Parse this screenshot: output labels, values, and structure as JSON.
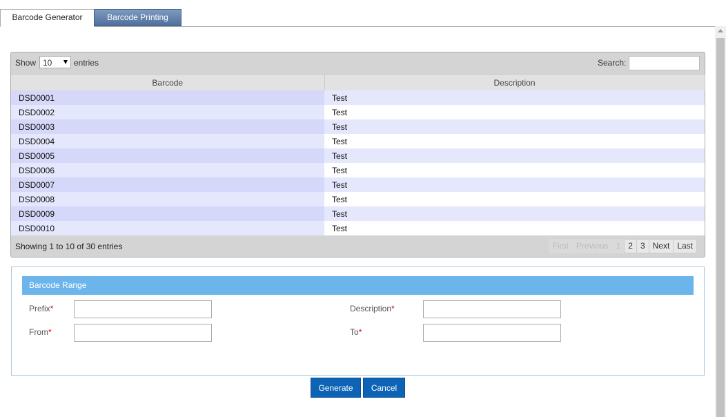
{
  "tabs": [
    {
      "label": "Barcode Generator",
      "active": true
    },
    {
      "label": "Barcode Printing",
      "active": false
    }
  ],
  "grid": {
    "show_label": "Show",
    "page_size": "10",
    "entries_label": "entries",
    "search_label": "Search:",
    "search_value": "",
    "columns": [
      "Barcode",
      "Description"
    ],
    "rows": [
      {
        "barcode": "DSD0001",
        "description": "Test"
      },
      {
        "barcode": "DSD0002",
        "description": "Test"
      },
      {
        "barcode": "DSD0003",
        "description": "Test"
      },
      {
        "barcode": "DSD0004",
        "description": "Test"
      },
      {
        "barcode": "DSD0005",
        "description": "Test"
      },
      {
        "barcode": "DSD0006",
        "description": "Test"
      },
      {
        "barcode": "DSD0007",
        "description": "Test"
      },
      {
        "barcode": "DSD0008",
        "description": "Test"
      },
      {
        "barcode": "DSD0009",
        "description": "Test"
      },
      {
        "barcode": "DSD0010",
        "description": "Test"
      }
    ],
    "info": "Showing 1 to 10 of 30 entries",
    "pager": {
      "first": "First",
      "previous": "Previous",
      "pages": [
        "1",
        "2",
        "3"
      ],
      "next": "Next",
      "last": "Last"
    }
  },
  "range": {
    "title": "Barcode Range",
    "prefix_label": "Prefix",
    "from_label": "From",
    "description_label": "Description",
    "to_label": "To",
    "required_mark": "*"
  },
  "buttons": {
    "generate": "Generate",
    "cancel": "Cancel"
  }
}
